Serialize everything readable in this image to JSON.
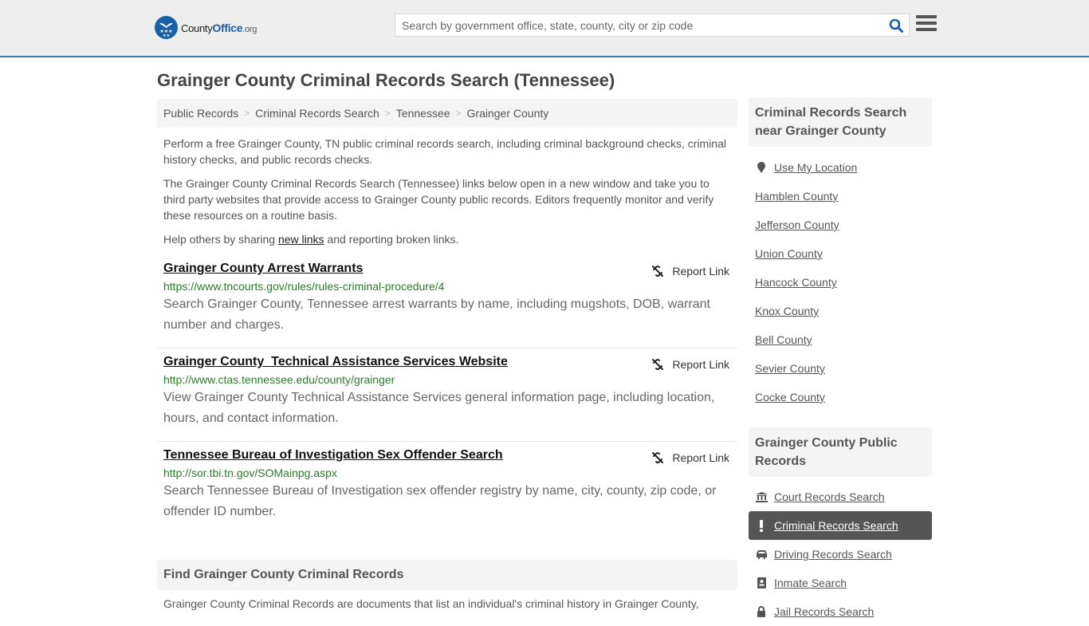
{
  "header": {
    "logo": {
      "county": "County",
      "office": "Office",
      "tld": ".org"
    },
    "search_placeholder": "Search by government office, state, county, city or zip code",
    "search_icon": "search-icon",
    "menu_icon": "hamburger-menu-icon"
  },
  "page": {
    "title": "Grainger County Criminal Records Search (Tennessee)",
    "breadcrumbs": [
      "Public Records",
      "Criminal Records Search",
      "Tennessee",
      "Grainger County"
    ],
    "intro_1": "Perform a free Grainger County, TN public criminal records search, including criminal background checks, criminal history checks, and public records checks.",
    "intro_2": "The Grainger County Criminal Records Search (Tennessee) links below open in a new window and take you to third party websites that provide access to Grainger County public records. Editors frequently monitor and verify these resources on a routine basis.",
    "help_prefix": "Help others by sharing ",
    "help_link": "new links",
    "help_suffix": " and reporting broken links."
  },
  "entries": [
    {
      "title": "Grainger County Arrest Warrants",
      "url": "https://www.tncourts.gov/rules/rules-criminal-procedure/4",
      "description": "Search Grainger County, Tennessee arrest warrants by name, including mugshots, DOB, warrant number and charges.",
      "report_label": "Report Link"
    },
    {
      "title": "Grainger County  Technical Assistance Services Website",
      "url": "http://www.ctas.tennessee.edu/county/grainger",
      "description": "View Grainger County Technical Assistance Services general information page, including location, hours, and contact information.",
      "report_label": "Report Link"
    },
    {
      "title": "Tennessee Bureau of Investigation Sex Offender Search",
      "url": "http://sor.tbi.tn.gov/SOMainpg.aspx",
      "description": "Search Tennessee Bureau of Investigation sex offender registry by name, city, county, zip code, or offender ID number.",
      "report_label": "Report Link"
    }
  ],
  "find_section": {
    "heading": "Find Grainger County Criminal Records",
    "text": "Grainger County Criminal Records are documents that list an individual's criminal history in Grainger County,"
  },
  "sidebar": {
    "nearby_heading": "Criminal Records Search near Grainger County",
    "use_location": "Use My Location",
    "nearby": [
      "Hamblen County",
      "Jefferson County",
      "Union County",
      "Hancock County",
      "Knox County",
      "Bell County",
      "Sevier County",
      "Cocke County"
    ],
    "public_heading": "Grainger County Public Records",
    "public_records": [
      {
        "label": "Court Records Search",
        "icon": "courthouse-icon",
        "active": false
      },
      {
        "label": "Criminal Records Search",
        "icon": "exclamation-icon",
        "active": true
      },
      {
        "label": "Driving Records Search",
        "icon": "car-icon",
        "active": false
      },
      {
        "label": "Inmate Search",
        "icon": "id-badge-icon",
        "active": false
      },
      {
        "label": "Jail Records Search",
        "icon": "lock-icon",
        "active": false
      }
    ]
  },
  "colors": {
    "brand_blue": "#1b5fa6",
    "header_border": "#3a7bab",
    "url_green": "#2b7a2b",
    "active_bg": "#555555"
  }
}
